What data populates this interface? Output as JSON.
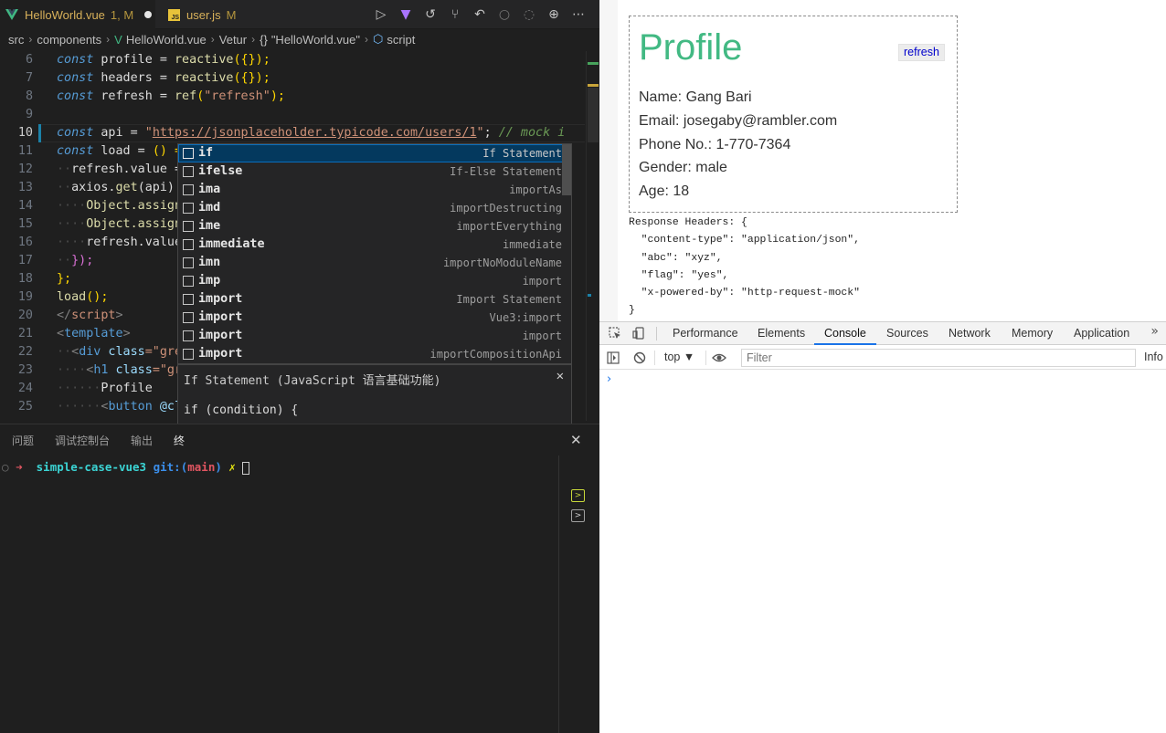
{
  "editor": {
    "tabs": [
      {
        "name": "HelloWorld.vue",
        "status": "1, M",
        "active": true
      },
      {
        "name": "user.js",
        "status": "M",
        "icon_text": "JS",
        "active": false
      }
    ],
    "toolbar_icons": [
      "run-icon",
      "vite-icon",
      "history-icon",
      "source-control-icon",
      "go-back-icon",
      "go-previous-change-icon",
      "go-next-change-icon",
      "timeline-icon",
      "more-icon"
    ],
    "breadcrumb": [
      "src",
      "components",
      "HelloWorld.vue",
      "Vetur",
      "\"HelloWorld.vue\"",
      "script"
    ],
    "line_numbers": [
      "6",
      "7",
      "8",
      "9",
      "10",
      "11",
      "12",
      "13",
      "14",
      "15",
      "16",
      "17",
      "18",
      "19",
      "20",
      "21",
      "22",
      "23",
      "24",
      "25"
    ],
    "active_line": "10",
    "lines": {
      "l6": {
        "kw": "const",
        "name": " profile = ",
        "fn": "reactive",
        "rest": "({});"
      },
      "l7": {
        "kw": "const",
        "name": " headers = ",
        "fn": "reactive",
        "rest": "({});"
      },
      "l8": {
        "kw": "const",
        "name": " refresh = ",
        "fn": "ref",
        "open": "(",
        "str": "\"refresh\"",
        "close": ");"
      },
      "l10": {
        "kw": "const",
        "name": " api = ",
        "q1": "\"",
        "url": "https://jsonplaceholder.typicode.com/users/1",
        "q2": "\"",
        "semi": "; ",
        "cmt": "// mock i"
      },
      "l11": {
        "kw": "const",
        "name": " load = ",
        "rest": "() ="
      },
      "l12": {
        "text": "refresh.value ="
      },
      "l13": {
        "a": "axios.",
        "fn": "get",
        "b": "(api)."
      },
      "l14": {
        "text": "Object.assign"
      },
      "l15": {
        "text": "Object.assign"
      },
      "l16": {
        "text": "refresh.value"
      },
      "l17": {
        "text": "});"
      },
      "l18": {
        "text": "};"
      },
      "l19": {
        "fn": "load",
        "rest": "();"
      },
      "l20": {
        "open": "</",
        "tag": "script",
        "close": ">"
      },
      "l21": {
        "open": "<",
        "tag": "template",
        "close": ">"
      },
      "l22": {
        "open": "<",
        "tag": "div",
        "attr": " class",
        "rest": "=\"gre"
      },
      "l23": {
        "open": "<",
        "tag": "h1",
        "attr": " class",
        "rest": "=\"gr"
      },
      "l24": {
        "text": "Profile"
      },
      "l25": {
        "open": "<",
        "tag": "button",
        "attr": " @cl"
      }
    },
    "suggestions": [
      {
        "label": "if",
        "detail": "If Statement",
        "selected": true
      },
      {
        "label": "ifelse",
        "detail": "If-Else Statement"
      },
      {
        "label": "ima",
        "detail": "importAs"
      },
      {
        "label": "imd",
        "detail": "importDestructing"
      },
      {
        "label": "ime",
        "detail": "importEverything"
      },
      {
        "label": "immediate",
        "detail": "immediate"
      },
      {
        "label": "imn",
        "detail": "importNoModuleName"
      },
      {
        "label": "imp",
        "detail": "import"
      },
      {
        "label": "import",
        "detail": "Import Statement"
      },
      {
        "label": "import",
        "detail": "Vue3:import"
      },
      {
        "label": "import",
        "detail": "import"
      },
      {
        "label": "import",
        "detail": "importCompositionApi"
      }
    ],
    "suggest_doc": {
      "title": "If Statement (JavaScript 语言基础功能)",
      "code_line1": "if (condition) {",
      "code_line2": "}"
    },
    "panel": {
      "tabs": [
        "问题",
        "调试控制台",
        "输出",
        "终"
      ],
      "terminal": {
        "dot": "○",
        "arrow": "➜",
        "dir": "simple-case-vue3",
        "git": "git:(",
        "branch": "main",
        "git_close": ")",
        "dirty": "✗"
      }
    }
  },
  "browser": {
    "profile": {
      "title": "Profile",
      "refresh_label": "refresh",
      "fields": [
        "Name: Gang Bari",
        "Email: josegaby@rambler.com",
        "Phone No.: 1-770-7364",
        "Gender: male",
        "Age: 18"
      ]
    },
    "response_headers_text": "Response Headers: {\n  \"content-type\": \"application/json\",\n  \"abc\": \"xyz\",\n  \"flag\": \"yes\",\n  \"x-powered-by\": \"http-request-mock\"\n}",
    "devtools": {
      "tabs": [
        "Performance",
        "Elements",
        "Console",
        "Sources",
        "Network",
        "Memory",
        "Application"
      ],
      "active_tab": "Console",
      "context": "top",
      "filter_placeholder": "Filter",
      "levels": "Info",
      "prompt": "›"
    }
  },
  "colors": {
    "vue_green": "#42b983",
    "editor_bg": "#1f1f1f",
    "suggest_selected": "#04395e",
    "devtools_accent": "#1a73e8"
  }
}
